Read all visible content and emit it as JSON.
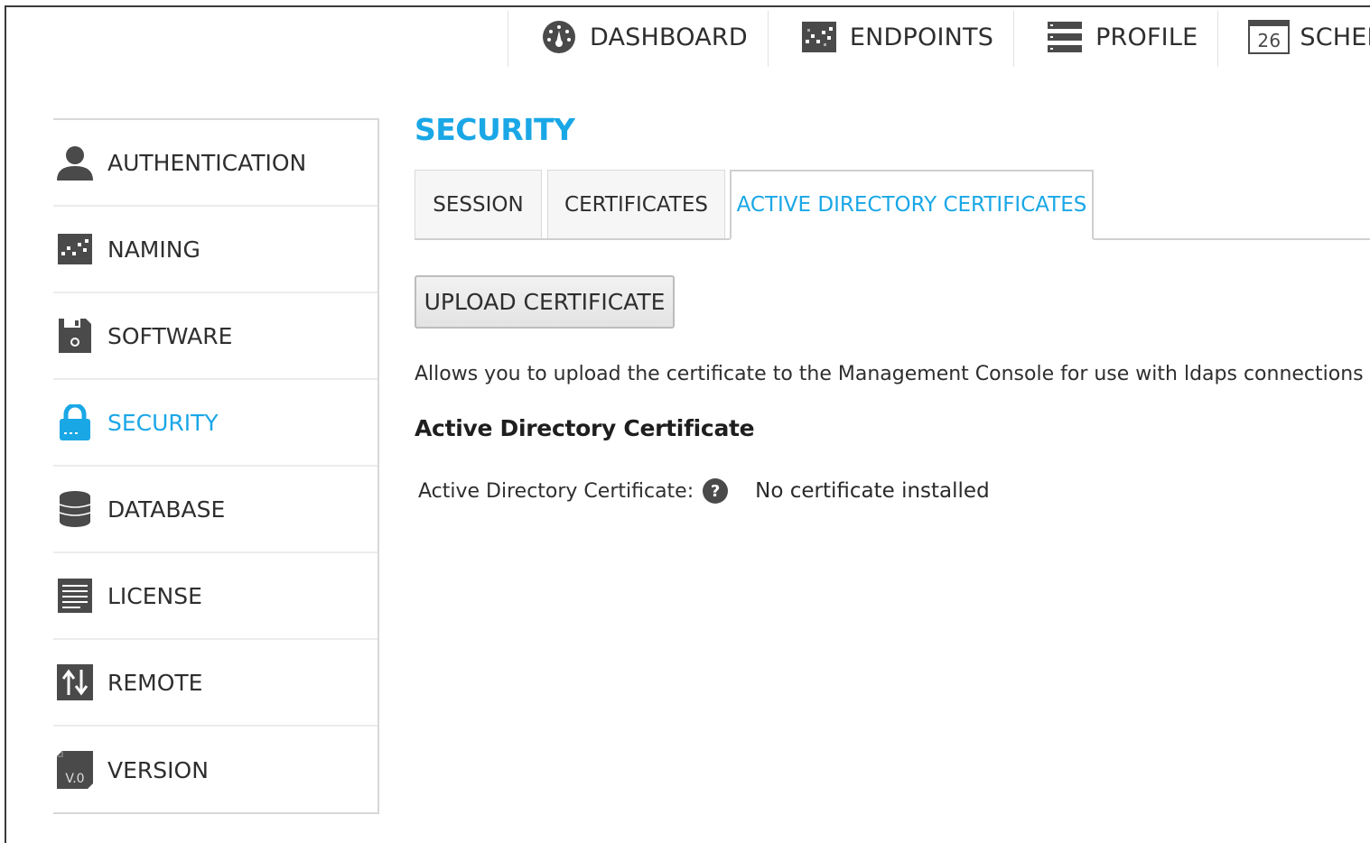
{
  "topnav": {
    "items": [
      {
        "label": "DASHBOARD",
        "icon": "dashboard-gauge-icon"
      },
      {
        "label": "ENDPOINTS",
        "icon": "endpoints-grid-icon"
      },
      {
        "label": "PROFILE",
        "icon": "profile-list-icon"
      },
      {
        "label": "SCHEDUL",
        "icon": "calendar-icon",
        "icon_text": "26"
      }
    ]
  },
  "sidebar": {
    "items": [
      {
        "label": "AUTHENTICATION",
        "icon": "user-icon"
      },
      {
        "label": "NAMING",
        "icon": "naming-grid-icon"
      },
      {
        "label": "SOFTWARE",
        "icon": "floppy-disk-icon"
      },
      {
        "label": "SECURITY",
        "icon": "lock-icon",
        "active": true
      },
      {
        "label": "DATABASE",
        "icon": "database-icon"
      },
      {
        "label": "LICENSE",
        "icon": "license-document-icon"
      },
      {
        "label": "REMOTE",
        "icon": "transfer-arrows-icon"
      },
      {
        "label": "VERSION",
        "icon": "version-icon",
        "icon_text": "V.0"
      }
    ]
  },
  "main": {
    "title": "SECURITY",
    "tabs": [
      {
        "label": "SESSION"
      },
      {
        "label": "CERTIFICATES"
      },
      {
        "label": "ACTIVE DIRECTORY CERTIFICATES",
        "active": true
      }
    ],
    "upload_button": "UPLOAD CERTIFICATE",
    "description": "Allows you to upload the certificate to the Management Console for use with ldaps connections to a",
    "section_heading": "Active Directory Certificate",
    "field_label": "Active Directory Certificate:",
    "help_glyph": "?",
    "field_value": "No certificate installed"
  },
  "colors": {
    "accent": "#1aa7e6",
    "text": "#2e2e2e",
    "icon_gray": "#4a4a4a"
  }
}
